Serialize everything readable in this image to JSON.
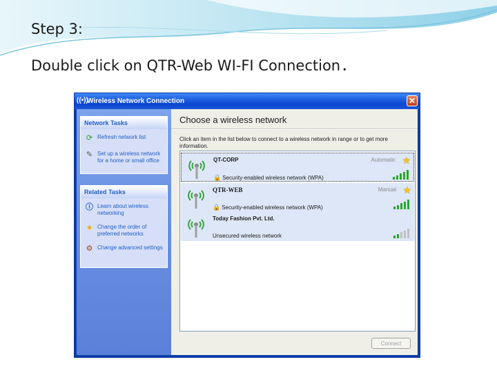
{
  "slide": {
    "title": "Step 3:",
    "body": "Double click on QTR-Web WI-FI Connection",
    "body_end": "."
  },
  "window": {
    "title": "Wireless Network Connection",
    "close_glyph": "✕",
    "title_icon": "wireless-network-icon"
  },
  "sidebar": {
    "network_tasks": {
      "header": "Network Tasks",
      "items": [
        {
          "label": "Refresh network list",
          "icon": "refresh-icon"
        },
        {
          "label": "Set up a wireless network for a home or small office",
          "icon": "setup-network-icon"
        }
      ]
    },
    "related_tasks": {
      "header": "Related Tasks",
      "items": [
        {
          "label": "Learn about wireless networking",
          "icon": "info-icon"
        },
        {
          "label": "Change the order of preferred networks",
          "icon": "star-icon"
        },
        {
          "label": "Change advanced settings",
          "icon": "settings-icon"
        }
      ]
    }
  },
  "main": {
    "heading": "Choose a wireless network",
    "intro": "Click an item in the list below to connect to a wireless network in range or to get more information.",
    "networks": [
      {
        "name": "QT-CORP",
        "status": "Automatic",
        "security": "Security-enabled wireless network (WPA)",
        "secured": true,
        "preferred": true,
        "signal_bars": 5
      },
      {
        "name": "QTR-WEB",
        "status": "Manual",
        "security": "Security-enabled wireless network (WPA)",
        "secured": true,
        "preferred": true,
        "signal_bars": 5
      },
      {
        "name": "Today Fashion Pvt. Ltd.",
        "status": "",
        "security": "Unsecured wireless network",
        "secured": false,
        "preferred": false,
        "signal_bars": 2
      }
    ],
    "connect_label": "Connect"
  },
  "colors": {
    "titlebar": "#0b46cf",
    "sidebar": "#6a92e3",
    "link": "#215dc6",
    "row_highlight": "#dee7f7",
    "signal": "#2aa52a"
  }
}
